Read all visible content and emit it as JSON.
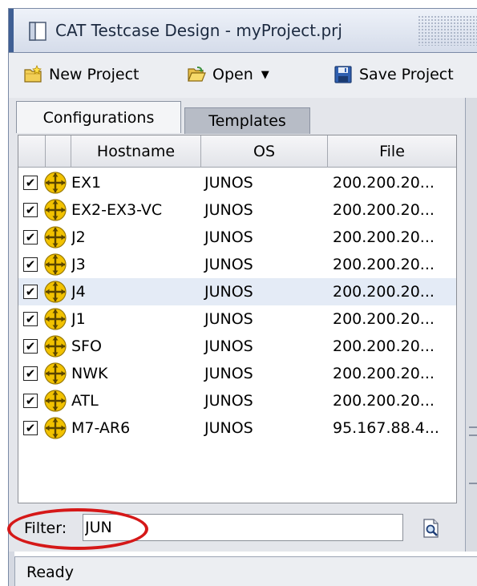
{
  "window": {
    "title": "CAT Testcase Design - myProject.prj"
  },
  "toolbar": {
    "new_project": "New Project",
    "open": "Open",
    "save_project": "Save Project"
  },
  "tabs": [
    {
      "label": "Configurations",
      "active": true
    },
    {
      "label": "Templates",
      "active": false
    }
  ],
  "table": {
    "columns": [
      "",
      "",
      "Hostname",
      "OS",
      "File"
    ],
    "rows": [
      {
        "checked": true,
        "hostname": "EX1",
        "os": "JUNOS",
        "file": "200.200.20...",
        "selected": false
      },
      {
        "checked": true,
        "hostname": "EX2-EX3-VC",
        "os": "JUNOS",
        "file": "200.200.20...",
        "selected": false
      },
      {
        "checked": true,
        "hostname": "J2",
        "os": "JUNOS",
        "file": "200.200.20...",
        "selected": false
      },
      {
        "checked": true,
        "hostname": "J3",
        "os": "JUNOS",
        "file": "200.200.20...",
        "selected": false
      },
      {
        "checked": true,
        "hostname": "J4",
        "os": "JUNOS",
        "file": "200.200.20...",
        "selected": true
      },
      {
        "checked": true,
        "hostname": "J1",
        "os": "JUNOS",
        "file": "200.200.20...",
        "selected": false
      },
      {
        "checked": true,
        "hostname": "SFO",
        "os": "JUNOS",
        "file": "200.200.20...",
        "selected": false
      },
      {
        "checked": true,
        "hostname": "NWK",
        "os": "JUNOS",
        "file": "200.200.20...",
        "selected": false
      },
      {
        "checked": true,
        "hostname": "ATL",
        "os": "JUNOS",
        "file": "200.200.20...",
        "selected": false
      },
      {
        "checked": true,
        "hostname": "M7-AR6",
        "os": "JUNOS",
        "file": "95.167.88.4...",
        "selected": false
      }
    ]
  },
  "filter": {
    "label": "Filter:",
    "value": "JUN"
  },
  "status": {
    "text": "Ready"
  },
  "icons": {
    "window": "window-icon",
    "new_project": "new-project-icon",
    "open": "open-folder-icon",
    "save": "floppy-disk-icon",
    "router": "router-icon",
    "filter_search": "find-document-icon"
  },
  "colors": {
    "annotation_circle": "#d51818",
    "selected_row": "#e4ebf6",
    "router_icon": "#f2c200"
  }
}
